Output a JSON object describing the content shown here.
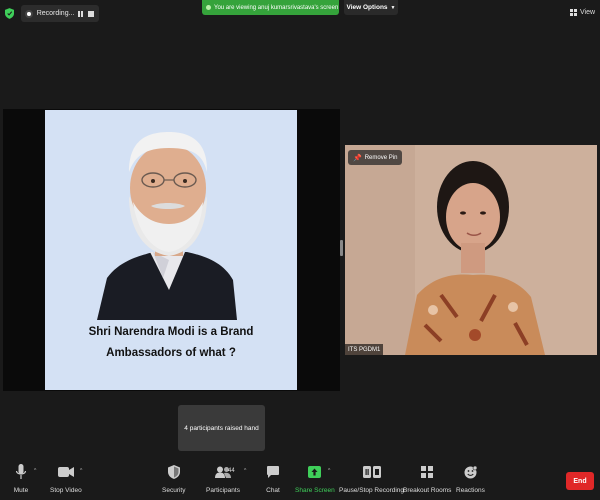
{
  "header": {
    "recording_label": "Recording...",
    "banner_text": "You are viewing anuj kumarsrivastava's screen",
    "view_options_label": "View Options",
    "view_label": "View"
  },
  "shared_screen": {
    "slide_line1": "Shri Narendra Modi is a Brand",
    "slide_line2": "Ambassadors of what ?"
  },
  "video": {
    "pin_label": "Remove Pin",
    "participant_name": "ITS PGDM1"
  },
  "notification": {
    "text": "4 participants raised hand"
  },
  "toolbar": {
    "mute_label": "Mute",
    "stop_video_label": "Stop Video",
    "security_label": "Security",
    "participants_label": "Participants",
    "participants_count": "44",
    "chat_label": "Chat",
    "share_screen_label": "Share Screen",
    "recording_label": "Pause/Stop Recording",
    "breakout_label": "Breakout Rooms",
    "reactions_label": "Reactions",
    "end_label": "End"
  },
  "colors": {
    "banner_green": "#35a33b",
    "share_green": "#3fcf5a",
    "end_red": "#e02828"
  },
  "icons": [
    "shield-icon",
    "recording-icon",
    "pause-icon",
    "stop-icon",
    "grid-icon",
    "pin-icon",
    "microphone-icon",
    "video-camera-icon",
    "security-shield-icon",
    "participants-icon",
    "chat-icon",
    "share-screen-icon",
    "recording-pause-icon",
    "breakout-rooms-icon",
    "reactions-icon"
  ]
}
